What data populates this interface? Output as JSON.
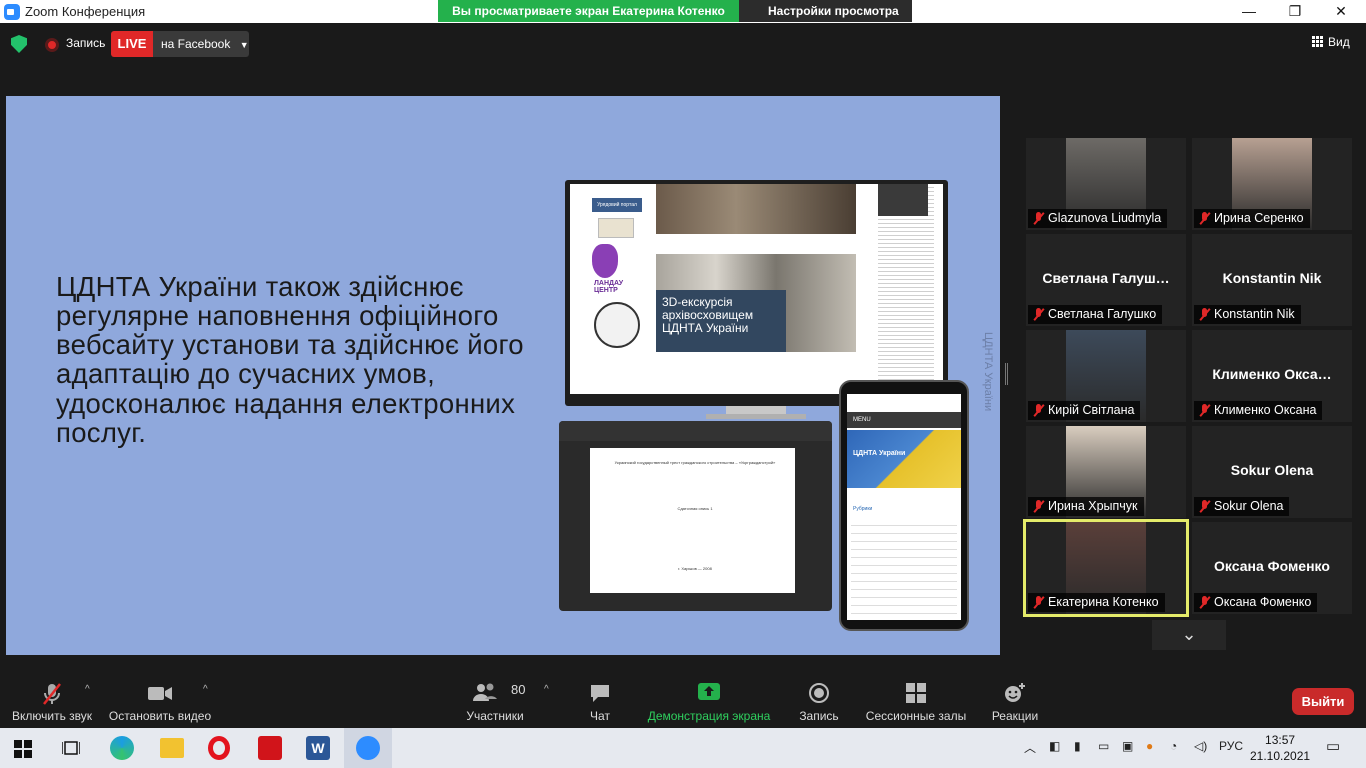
{
  "window": {
    "title": "Zoom Конференция",
    "minimize": "—",
    "maximize": "❐",
    "close": "✕"
  },
  "share": {
    "banner": "Вы просматриваете экран Екатерина Котенко",
    "view_settings": "Настройки просмотра"
  },
  "topbar": {
    "record_label": "Запись",
    "live_label": "LIVE",
    "live_destination": "на Facebook",
    "view_label": "Вид"
  },
  "slide": {
    "text": "ЦДНТА України також здійснює регулярне наповнення офіційного вебсайту установи та здійснює його адаптацію до сучасних умов, удосконалює надання електронних послуг.",
    "vertical_label": "ЦДНТА України",
    "monitor_caption": "3D-екскурсія архівосховищем ЦДНТА України",
    "monitor_side_1": "Урядовий портал",
    "monitor_side_2": "ЛАНДАУ ЦЕНТР",
    "laptop_doc_title": "Украинский государственный трест гражданского строительства – «Укргражданстрой»",
    "laptop_doc_sub": "Сдаточная опись 1",
    "laptop_doc_city": "г. Харьков — 2008",
    "phone_menu": "MENU",
    "phone_site_title": "ЦДНТА України",
    "phone_section": "Рубрики"
  },
  "participants": [
    {
      "name": "Glazunova Liudmyla",
      "video": true,
      "color": "#6d6a66"
    },
    {
      "name": "Ирина Серенко",
      "video": true,
      "color": "#b7a092"
    },
    {
      "name": "Светлана Галушко",
      "display": "Светлана  Галуш…",
      "video": false
    },
    {
      "name": "Konstantin Nik",
      "display": "Konstantin Nik",
      "video": false
    },
    {
      "name": "Кирій Світлана",
      "video": true,
      "color": "#3d4a5a"
    },
    {
      "name": "Клименко Оксана",
      "display": "Клименко  Окса…",
      "video": false
    },
    {
      "name": "Ирина Хрыпчук",
      "video": true,
      "color": "#d9cdbf"
    },
    {
      "name": "Sokur Olena",
      "display": "Sokur Olena",
      "video": false
    },
    {
      "name": "Екатерина Котенко",
      "video": true,
      "color": "#5a3f3a",
      "active": true
    },
    {
      "name": "Оксана Фоменко",
      "display": "Оксана Фоменко",
      "video": false
    }
  ],
  "toolbar": {
    "unmute": "Включить звук",
    "stop_video": "Остановить видео",
    "participants": "Участники",
    "participants_count": "80",
    "chat": "Чат",
    "share": "Демонстрация экрана",
    "record": "Запись",
    "breakout": "Сессионные залы",
    "reactions": "Реакции",
    "leave": "Выйти"
  },
  "taskbar": {
    "lang": "РУС",
    "time": "13:57",
    "date": "21.10.2021"
  },
  "colors": {
    "accent_green": "#24b14c",
    "live_red": "#e02828",
    "slide_bg": "#8fa8dc",
    "active_speaker": "#e4eb6a"
  }
}
